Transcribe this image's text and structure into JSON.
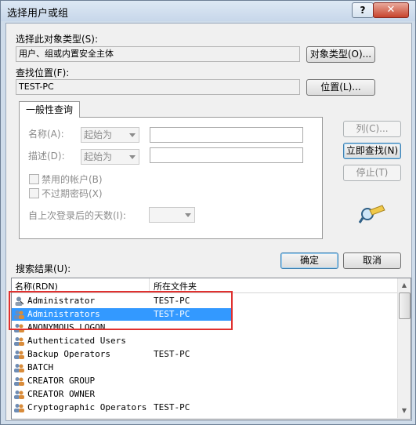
{
  "window": {
    "title": "选择用户或组",
    "help_label": "?",
    "close_label": "✕"
  },
  "object_type": {
    "label": "选择此对象类型(S):",
    "value": "用户、组或内置安全主体",
    "button": "对象类型(O)..."
  },
  "location": {
    "label": "查找位置(F):",
    "value": "TEST-PC",
    "button": "位置(L)..."
  },
  "query": {
    "tab": "一般性查询",
    "name_label": "名称(A):",
    "name_mode": "起始为",
    "desc_label": "描述(D):",
    "desc_mode": "起始为",
    "disabled_accounts": "禁用的帐户(B)",
    "non_expiring_pw": "不过期密码(X)",
    "days_since_logon": "自上次登录后的天数(I):"
  },
  "side_buttons": {
    "columns": "列(C)...",
    "find_now": "立即查找(N)",
    "stop": "停止(T)"
  },
  "ok": "确定",
  "cancel": "取消",
  "results": {
    "label": "搜索结果(U):",
    "col_name": "名称(RDN)",
    "col_folder": "所在文件夹",
    "rows": [
      {
        "name": "Administrator",
        "folder": "TEST-PC"
      },
      {
        "name": "Administrators",
        "folder": "TEST-PC"
      },
      {
        "name": "ANONYMOUS LOGON",
        "folder": ""
      },
      {
        "name": "Authenticated Users",
        "folder": ""
      },
      {
        "name": "Backup Operators",
        "folder": "TEST-PC"
      },
      {
        "name": "BATCH",
        "folder": ""
      },
      {
        "name": "CREATOR GROUP",
        "folder": ""
      },
      {
        "name": "CREATOR OWNER",
        "folder": ""
      },
      {
        "name": "Cryptographic Operators",
        "folder": "TEST-PC"
      }
    ]
  },
  "colors": {
    "selection": "#3399ff",
    "highlight_box": "#e0312f",
    "title_bar": "#cfdcea"
  }
}
